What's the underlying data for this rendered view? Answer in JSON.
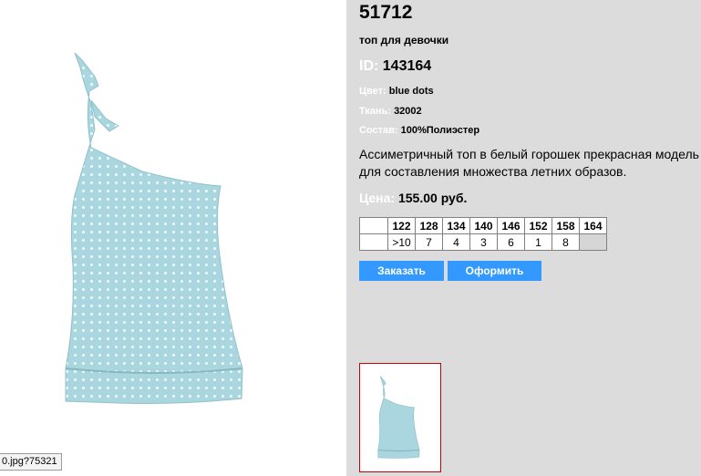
{
  "status_url": "0.jpg?75321",
  "product": {
    "article": "51712",
    "name": "топ для девочки",
    "id_label": "ID:",
    "id_value": "143164",
    "color_label": "Цвет:",
    "color_value": "blue dots",
    "fabric_label": "Ткань:",
    "fabric_value": "32002",
    "composition_label": "Состав:",
    "composition_value": "100%Полиэстер",
    "description": "Ассиметричный топ в белый горошек прекрасная модель для составления множества летних образов.",
    "price_label": "Цена:",
    "price_value": "155.00 руб."
  },
  "sizes": {
    "headers": [
      "122",
      "128",
      "134",
      "140",
      "146",
      "152",
      "158",
      "164"
    ],
    "stock": [
      ">10",
      "7",
      "4",
      "3",
      "6",
      "1",
      "8",
      ""
    ]
  },
  "buttons": {
    "order": "Заказать",
    "checkout": "Оформить"
  },
  "colors": {
    "right_panel_bg": "#dcdcdc",
    "button_bg": "#3399ff",
    "garment": "#a9d6df",
    "thumbnail_border": "#cc0000"
  },
  "icons": {
    "product_image": "garment-photo",
    "thumbnail": "garment-thumbnail"
  }
}
